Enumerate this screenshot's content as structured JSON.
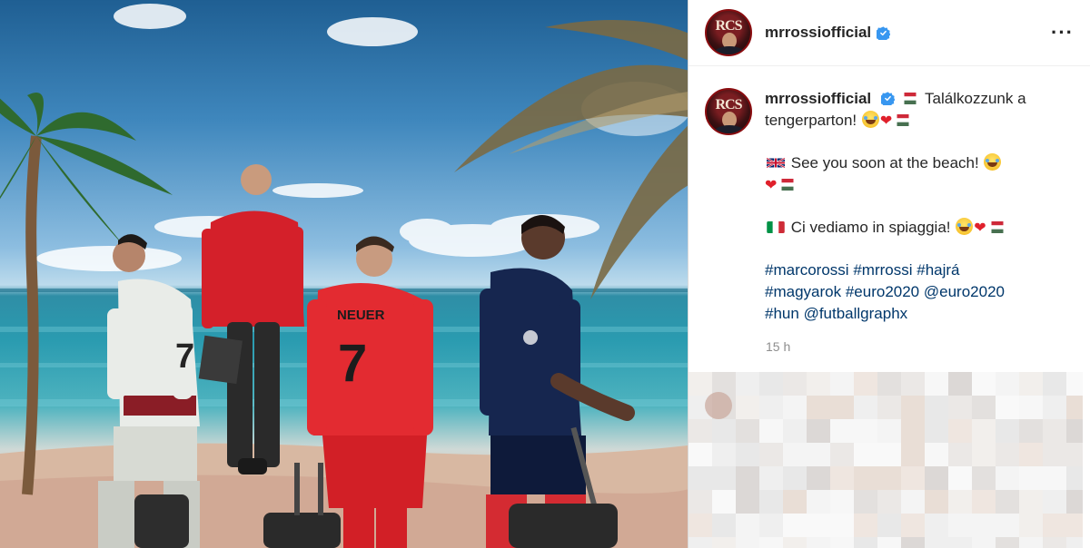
{
  "post": {
    "username": "mrrossiofficial",
    "avatar_initials": "RCS",
    "more_icon": "more-horizontal-icon",
    "verified_icon": "verified-badge-icon",
    "time": "15 h"
  },
  "caption": {
    "line1_text": "Találkozzunk a tengerparton!",
    "line2_text": "See you soon at the beach!",
    "line3_text": "Ci vediamo in spiaggia!",
    "hashtags": [
      "#marcorossi",
      "#mrrossi",
      "#hajrá",
      "#magyarok",
      "#euro2020"
    ],
    "mentions": [
      "@euro2020",
      "@futballgraphx"
    ],
    "last_tag": "#hun"
  },
  "image": {
    "player_names": [
      "NEUER"
    ],
    "player_numbers": [
      "7",
      "7"
    ],
    "sea_color": "#2a9bb0",
    "sky_color": "#3f87bd",
    "accent_red": "#d4202a",
    "navy": "#16264f"
  },
  "colors": {
    "link": "#00376b",
    "verified": "#3897f0",
    "muted": "#8e8e8e"
  }
}
